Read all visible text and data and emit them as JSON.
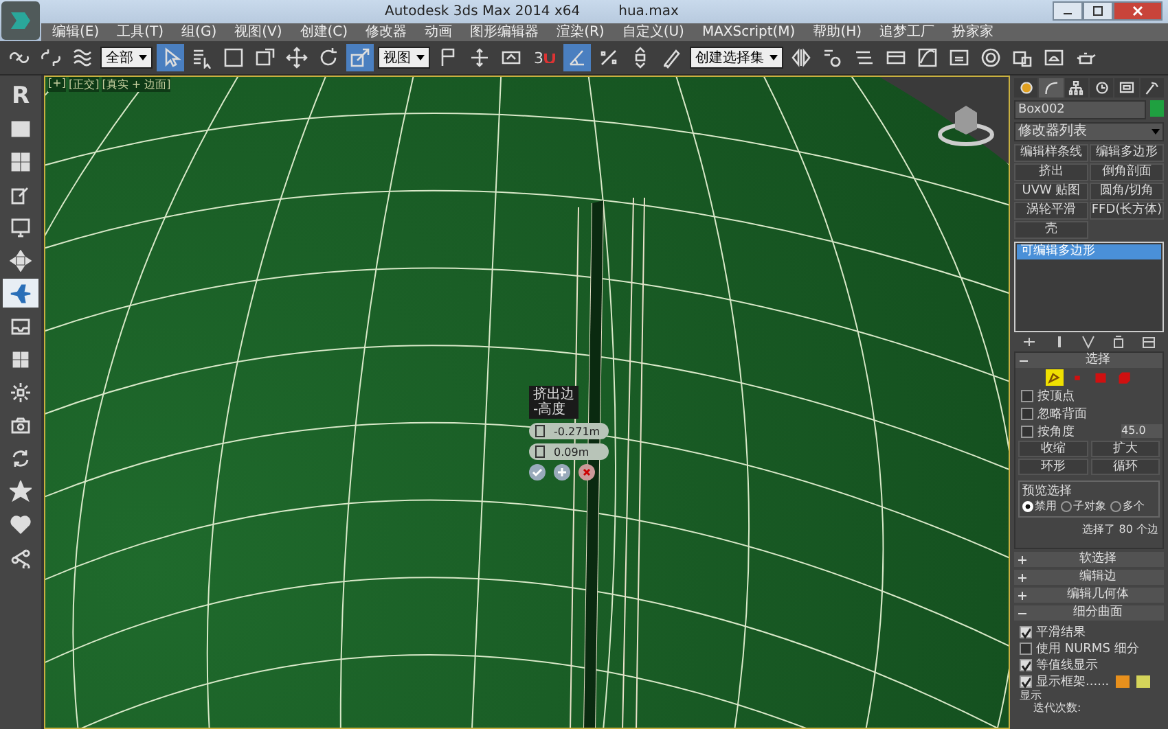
{
  "window": {
    "title": "Autodesk 3ds Max  2014 x64",
    "file": "hua.max"
  },
  "menu": [
    "编辑(E)",
    "工具(T)",
    "组(G)",
    "视图(V)",
    "创建(C)",
    "修改器",
    "动画",
    "图形编辑器",
    "渲染(R)",
    "自定义(U)",
    "MAXScript(M)",
    "帮助(H)",
    "追梦工厂",
    "扮家家"
  ],
  "toolbar": [
    {
      "kind": "icon",
      "selected": false
    },
    {
      "kind": "icon",
      "selected": false
    },
    {
      "kind": "icon",
      "selected": false
    },
    {
      "kind": "dropdown",
      "value": "全部"
    },
    {
      "kind": "icon",
      "selected": true
    },
    {
      "kind": "icon",
      "selected": false
    },
    {
      "kind": "icon",
      "selected": false
    },
    {
      "kind": "icon",
      "selected": false
    },
    {
      "kind": "icon",
      "selected": false
    },
    {
      "kind": "icon",
      "selected": false
    },
    {
      "kind": "icon",
      "selected": true
    },
    {
      "kind": "dropdown",
      "value": "视图"
    },
    {
      "kind": "icon",
      "selected": false
    },
    {
      "kind": "icon",
      "selected": false
    },
    {
      "kind": "icon",
      "selected": false
    },
    {
      "kind": "snap",
      "label": "3",
      "selected": false
    },
    {
      "kind": "icon",
      "selected": true
    },
    {
      "kind": "icon",
      "selected": false
    },
    {
      "kind": "icon",
      "selected": false
    },
    {
      "kind": "icon",
      "selected": false
    },
    {
      "kind": "dropdown",
      "value": "创建选择集"
    },
    {
      "kind": "icon",
      "selected": false
    },
    {
      "kind": "icon",
      "selected": false
    },
    {
      "kind": "icon",
      "selected": false
    },
    {
      "kind": "icon",
      "selected": false
    },
    {
      "kind": "icon",
      "selected": false
    },
    {
      "kind": "icon",
      "selected": false
    },
    {
      "kind": "icon",
      "selected": false
    },
    {
      "kind": "icon",
      "selected": false
    },
    {
      "kind": "icon",
      "selected": false
    },
    {
      "kind": "icon",
      "selected": false
    }
  ],
  "sidebar": [
    {
      "kind": "logo",
      "label": "R",
      "selected": false
    },
    {
      "kind": "icon",
      "selected": false
    },
    {
      "kind": "icon",
      "selected": false
    },
    {
      "kind": "icon",
      "selected": false
    },
    {
      "kind": "icon",
      "selected": false
    },
    {
      "kind": "icon",
      "selected": false
    },
    {
      "kind": "icon",
      "selected": true
    },
    {
      "kind": "icon",
      "selected": false
    },
    {
      "kind": "icon",
      "selected": false
    },
    {
      "kind": "icon",
      "selected": false
    },
    {
      "kind": "icon",
      "selected": false
    },
    {
      "kind": "icon",
      "selected": false
    },
    {
      "kind": "icon",
      "selected": false
    },
    {
      "kind": "icon",
      "selected": false
    },
    {
      "kind": "icon",
      "selected": false
    }
  ],
  "viewport": {
    "labels": [
      "[+]",
      "[正交]",
      "[真实 + 边面]"
    ],
    "caddy": {
      "title": "挤出边",
      "subtitle": "-高度",
      "fields": [
        "-0.271m",
        "0.09m"
      ]
    }
  },
  "command_panel": {
    "tabs": [
      {
        "selected": false
      },
      {
        "selected": true
      },
      {
        "selected": false
      },
      {
        "selected": false
      },
      {
        "selected": false
      },
      {
        "selected": false
      }
    ],
    "object_name": "Box002",
    "modifier_list": "修改器列表",
    "modifier_buttons": [
      "编辑样条线",
      "编辑多边形",
      "挤出",
      "倒角剖面",
      "UVW 贴图",
      "圆角/切角",
      "涡轮平滑",
      "FFD(长方体)",
      "壳"
    ],
    "stack": [
      {
        "label": "可编辑多边形",
        "selected": true
      }
    ],
    "selection": {
      "title": "选择",
      "expanded": true,
      "modes": [
        {
          "selected": true
        },
        {
          "selected": false
        },
        {
          "selected": false
        },
        {
          "selected": false
        }
      ],
      "checkboxes": [
        {
          "label": "按顶点",
          "checked": false
        },
        {
          "label": "忽略背面",
          "checked": false
        },
        {
          "label": "按角度",
          "checked": false
        }
      ],
      "angle_value": "45.0",
      "buttons": [
        "收缩",
        "扩大"
      ],
      "spinner_buttons": [
        "环形",
        "循环"
      ],
      "preview": {
        "title": "预览选择",
        "options": [
          {
            "label": "禁用",
            "selected": true
          },
          {
            "label": "子对象",
            "selected": false
          },
          {
            "label": "多个",
            "selected": false
          }
        ]
      },
      "status": "选择了 80 个边"
    },
    "rollouts": [
      {
        "title": "软选择",
        "expanded": false
      },
      {
        "title": "编辑边",
        "expanded": false
      },
      {
        "title": "编辑几何体",
        "expanded": false
      },
      {
        "title": "细分曲面",
        "expanded": true
      }
    ],
    "subdivision": {
      "checkboxes": [
        {
          "label": "平滑结果",
          "checked": true
        },
        {
          "label": "使用 NURMS 细分",
          "checked": false
        },
        {
          "label": "等值线显示",
          "checked": true
        },
        {
          "label": "显示框架......",
          "checked": true
        }
      ],
      "frame_colors": [
        {
          "color": "#e8901c"
        },
        {
          "color": "#d4d45a"
        }
      ],
      "group_title": "显示",
      "iterations_label": "迭代次数:"
    }
  }
}
